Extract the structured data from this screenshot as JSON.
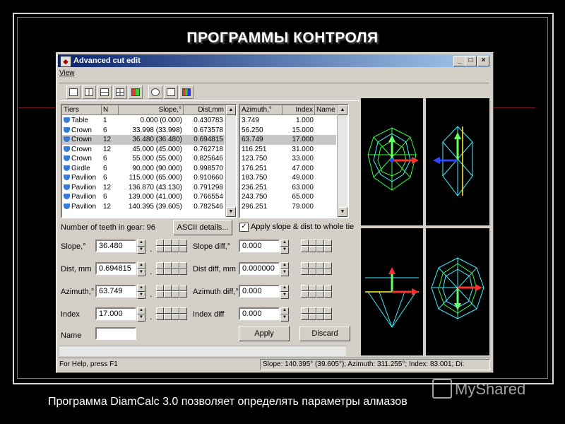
{
  "slide": {
    "title": "ПРОГРАММЫ КОНТРОЛЯ",
    "caption": "Программа DiamCalc 3.0 позволяет определять параметры алмазов",
    "watermark": "MyShared"
  },
  "window": {
    "title": "Advanced cut edit",
    "menu": [
      "View"
    ],
    "controls": [
      "_",
      "□",
      "×"
    ]
  },
  "tiers_table": {
    "headers": [
      "Tiers",
      "N",
      "Slope,°",
      "Dist,mm"
    ],
    "rows": [
      {
        "tier": "Table",
        "n": "1",
        "slope": "0.000 (0.000)",
        "dist": "0.430783"
      },
      {
        "tier": "Crown",
        "n": "6",
        "slope": "33.998 (33.998)",
        "dist": "0.673578"
      },
      {
        "tier": "Crown",
        "n": "12",
        "slope": "36.480 (36.480)",
        "dist": "0.694815",
        "selected": true
      },
      {
        "tier": "Crown",
        "n": "12",
        "slope": "45.000 (45.000)",
        "dist": "0.762718"
      },
      {
        "tier": "Crown",
        "n": "6",
        "slope": "55.000 (55.000)",
        "dist": "0.825646"
      },
      {
        "tier": "Girdle",
        "n": "6",
        "slope": "90.000 (90.000)",
        "dist": "0.998570"
      },
      {
        "tier": "Pavilion",
        "n": "6",
        "slope": "115.000 (65.000)",
        "dist": "0.910660"
      },
      {
        "tier": "Pavilion",
        "n": "12",
        "slope": "136.870 (43.130)",
        "dist": "0.791298"
      },
      {
        "tier": "Pavilion",
        "n": "6",
        "slope": "139.000 (41.000)",
        "dist": "0.766554"
      },
      {
        "tier": "Pavilion",
        "n": "12",
        "slope": "140.395 (39.605)",
        "dist": "0.782546"
      }
    ]
  },
  "azimuth_table": {
    "headers": [
      "Azimuth,°",
      "Index",
      "Name"
    ],
    "rows": [
      {
        "azimuth": "3.749",
        "index": "1.000"
      },
      {
        "azimuth": "56.250",
        "index": "15.000"
      },
      {
        "azimuth": "63.749",
        "index": "17.000",
        "selected": true
      },
      {
        "azimuth": "116.251",
        "index": "31.000"
      },
      {
        "azimuth": "123.750",
        "index": "33.000"
      },
      {
        "azimuth": "176.251",
        "index": "47.000"
      },
      {
        "azimuth": "183.750",
        "index": "49.000"
      },
      {
        "azimuth": "236.251",
        "index": "63.000"
      },
      {
        "azimuth": "243.750",
        "index": "65.000"
      },
      {
        "azimuth": "296.251",
        "index": "79.000"
      }
    ]
  },
  "gear": {
    "label": "Number of teeth in gear: 96"
  },
  "ascii_button": "ASCII details...",
  "apply_checkbox": {
    "label": "Apply slope & dist to whole tie",
    "checked": true
  },
  "fields": {
    "slope": {
      "label": "Slope,°",
      "value": "36.480"
    },
    "dist": {
      "label": "Dist, mm",
      "value": "0.694815"
    },
    "azimuth": {
      "label": "Azimuth,°",
      "value": "63.749"
    },
    "index": {
      "label": "Index",
      "value": "17.000"
    },
    "name": {
      "label": "Name",
      "value": ""
    }
  },
  "diff_fields": {
    "slope": {
      "label": "Slope diff,°",
      "value": "0.000"
    },
    "dist": {
      "label": "Dist diff, mm",
      "value": "0.000000"
    },
    "azimuth": {
      "label": "Azimuth diff,°",
      "value": "0.000"
    },
    "index": {
      "label": "Index diff",
      "value": "0.000"
    }
  },
  "buttons": {
    "apply": "Apply",
    "discard": "Discard"
  },
  "status": {
    "help": "For Help, press F1",
    "info": "Slope: 140.395° (39.605°); Azimuth: 311.255°; Index: 83.001; Di:"
  },
  "colors": {
    "titlebar": "#0a246a",
    "selection": "#c7c7c7",
    "wire_green": "#39ff39",
    "wire_cyan": "#3ff0ff"
  }
}
